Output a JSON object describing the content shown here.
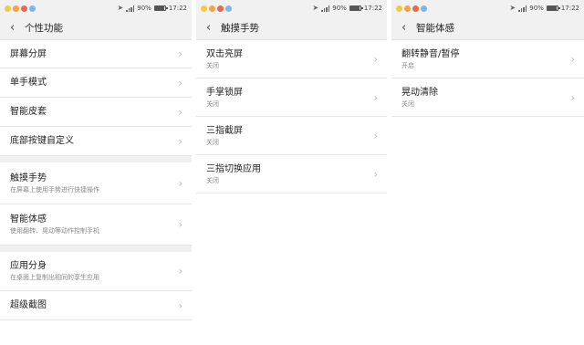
{
  "status": {
    "battery": "90%",
    "battery_level": 0.9,
    "time": "17:22",
    "dot_colors": [
      "#f2c94c",
      "#f4a340",
      "#e46a4f",
      "#7fb6e8"
    ]
  },
  "panels": [
    {
      "title": "个性功能",
      "groups": [
        [
          {
            "title": "屏幕分屏"
          },
          {
            "title": "单手模式"
          },
          {
            "title": "智能皮套"
          },
          {
            "title": "底部按键自定义"
          }
        ],
        [
          {
            "title": "触摸手势",
            "subtitle": "在屏幕上使用手势进行快捷操作"
          },
          {
            "title": "智能体感",
            "subtitle": "使用翻转、晃动等动作控制手机"
          }
        ],
        [
          {
            "title": "应用分身",
            "subtitle": "在桌面上复制出相同的孪生应用"
          },
          {
            "title": "超级截图"
          }
        ]
      ]
    },
    {
      "title": "触摸手势",
      "groups": [
        [
          {
            "title": "双击亮屏",
            "subtitle": "关闭"
          },
          {
            "title": "手掌锁屏",
            "subtitle": "关闭"
          },
          {
            "title": "三指截屏",
            "subtitle": "关闭"
          },
          {
            "title": "三指切换应用",
            "subtitle": "关闭"
          }
        ]
      ]
    },
    {
      "title": "智能体感",
      "groups": [
        [
          {
            "title": "翻转静音/暂停",
            "subtitle": "开启"
          },
          {
            "title": "晃动清除",
            "subtitle": "关闭"
          }
        ]
      ]
    }
  ]
}
